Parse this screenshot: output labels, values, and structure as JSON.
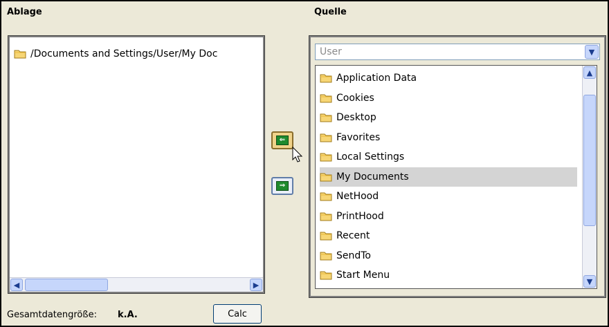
{
  "left_panel": {
    "title": "Ablage",
    "items": [
      {
        "label": "/Documents and Settings/User/My Doc",
        "icon": "folder-icon"
      }
    ]
  },
  "right_panel": {
    "title": "Quelle",
    "combo_value": "User",
    "items": [
      {
        "label": "Application Data",
        "icon": "folder-icon",
        "selected": false
      },
      {
        "label": "Cookies",
        "icon": "folder-icon",
        "selected": false
      },
      {
        "label": "Desktop",
        "icon": "folder-icon",
        "selected": false
      },
      {
        "label": "Favorites",
        "icon": "folder-icon",
        "selected": false
      },
      {
        "label": "Local Settings",
        "icon": "folder-icon",
        "selected": false
      },
      {
        "label": "My Documents",
        "icon": "folder-icon",
        "selected": true
      },
      {
        "label": "NetHood",
        "icon": "folder-icon",
        "selected": false
      },
      {
        "label": "PrintHood",
        "icon": "folder-icon",
        "selected": false
      },
      {
        "label": "Recent",
        "icon": "folder-icon",
        "selected": false
      },
      {
        "label": "SendTo",
        "icon": "folder-icon",
        "selected": false
      },
      {
        "label": "Start Menu",
        "icon": "folder-icon",
        "selected": false
      }
    ]
  },
  "buttons": {
    "move_left_icon": "arrow-left-icon",
    "move_right_icon": "arrow-right-icon",
    "calc_label": "Calc"
  },
  "footer": {
    "size_label": "Gesamtdatengröße:",
    "size_value": "k.A."
  },
  "colors": {
    "background": "#ece9d8",
    "selected_row": "#d4d4d4",
    "move_arrow": "#1f8a2e"
  }
}
